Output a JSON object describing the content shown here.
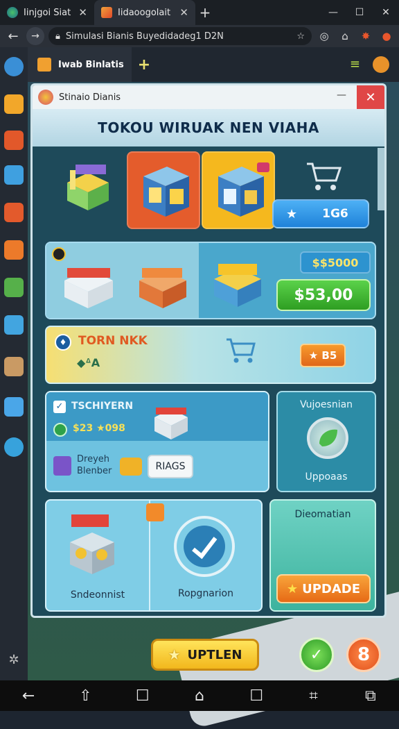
{
  "browser": {
    "tabs": [
      {
        "title": "Iinjgoi Siat",
        "close": "✕"
      },
      {
        "title": "Iidaoogolait",
        "close": "✕"
      }
    ],
    "new_tab": "+",
    "window_controls": [
      "—",
      "☐",
      "✕"
    ],
    "url": "Simulasi Bianis Buyedidadeg1 D2N"
  },
  "app": {
    "tab_title": "Iwab Binlatis",
    "plus": "+",
    "menu_glyph": "≡"
  },
  "window": {
    "title": "Stinaio Dianis",
    "minimize": "—",
    "close": "✕",
    "banner": "TOKOU WIRUAK NEN VIAHA"
  },
  "tier1": {
    "counter_star": "★",
    "counter_value": "1G6"
  },
  "tier2": {
    "price_small": "$$5000",
    "price_big": "$53,00"
  },
  "tier3": {
    "title": "TORN NKK",
    "subtitle": "◆ᐞA",
    "button": "★ B5"
  },
  "tier4": {
    "title": "TSCHIYERN",
    "value": "$23 ★098",
    "label": "Dreyeh Blenber",
    "button": "RIAGS"
  },
  "side_panel": {
    "title": "Vujoesnian",
    "subtitle": "Uppoaas"
  },
  "tier5": {
    "left_label": "Sndeonnist",
    "right_label": "Ropgnarion"
  },
  "discount_panel": {
    "title": "Dieomatian",
    "button_star": "★",
    "button": "UPDADE"
  },
  "bottom": {
    "main_star": "★",
    "main_button": "UPTLEN",
    "green_glyph": "✓",
    "orange_glyph": "8"
  },
  "android_nav": [
    "←",
    "⇧",
    "☐",
    "⌂",
    "☐",
    "⌗",
    "⧉"
  ],
  "colors": {
    "accent_orange": "#e45c2c",
    "accent_yellow": "#f5b81e",
    "accent_green": "#2e9e22",
    "accent_blue": "#1f82d9",
    "window_frame": "#1e4a5a"
  }
}
